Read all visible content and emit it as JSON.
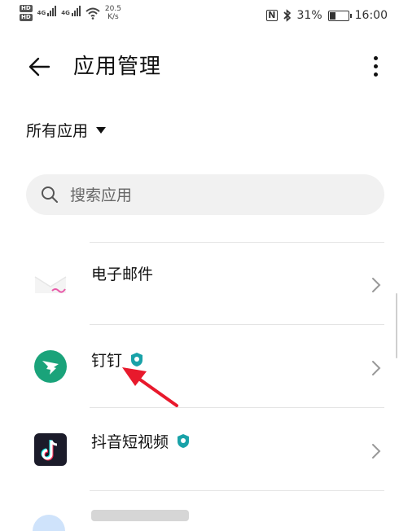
{
  "status_bar": {
    "hd1": "HD",
    "hd2": "HD",
    "net1": "4G",
    "net2": "4G",
    "speed_value": "20.5",
    "speed_unit": "K/s",
    "nfc": "N",
    "battery_text": "31%",
    "battery_level": 0.31,
    "time": "16:00"
  },
  "header": {
    "title": "应用管理"
  },
  "filter": {
    "label": "所有应用"
  },
  "search": {
    "placeholder": "搜索应用"
  },
  "apps": [
    {
      "name": "电子邮件",
      "icon": "envelope-icon",
      "badge": false
    },
    {
      "name": "钉钉",
      "icon": "dingtalk-icon",
      "badge": true
    },
    {
      "name": "抖音短视频",
      "icon": "tiktok-icon",
      "badge": true
    }
  ],
  "colors": {
    "dingtalk": "#1aa37a",
    "shield_badge": "#19a2a8",
    "tiktok_bg": "#1b1b2a",
    "annotation_arrow": "#e8192c"
  }
}
